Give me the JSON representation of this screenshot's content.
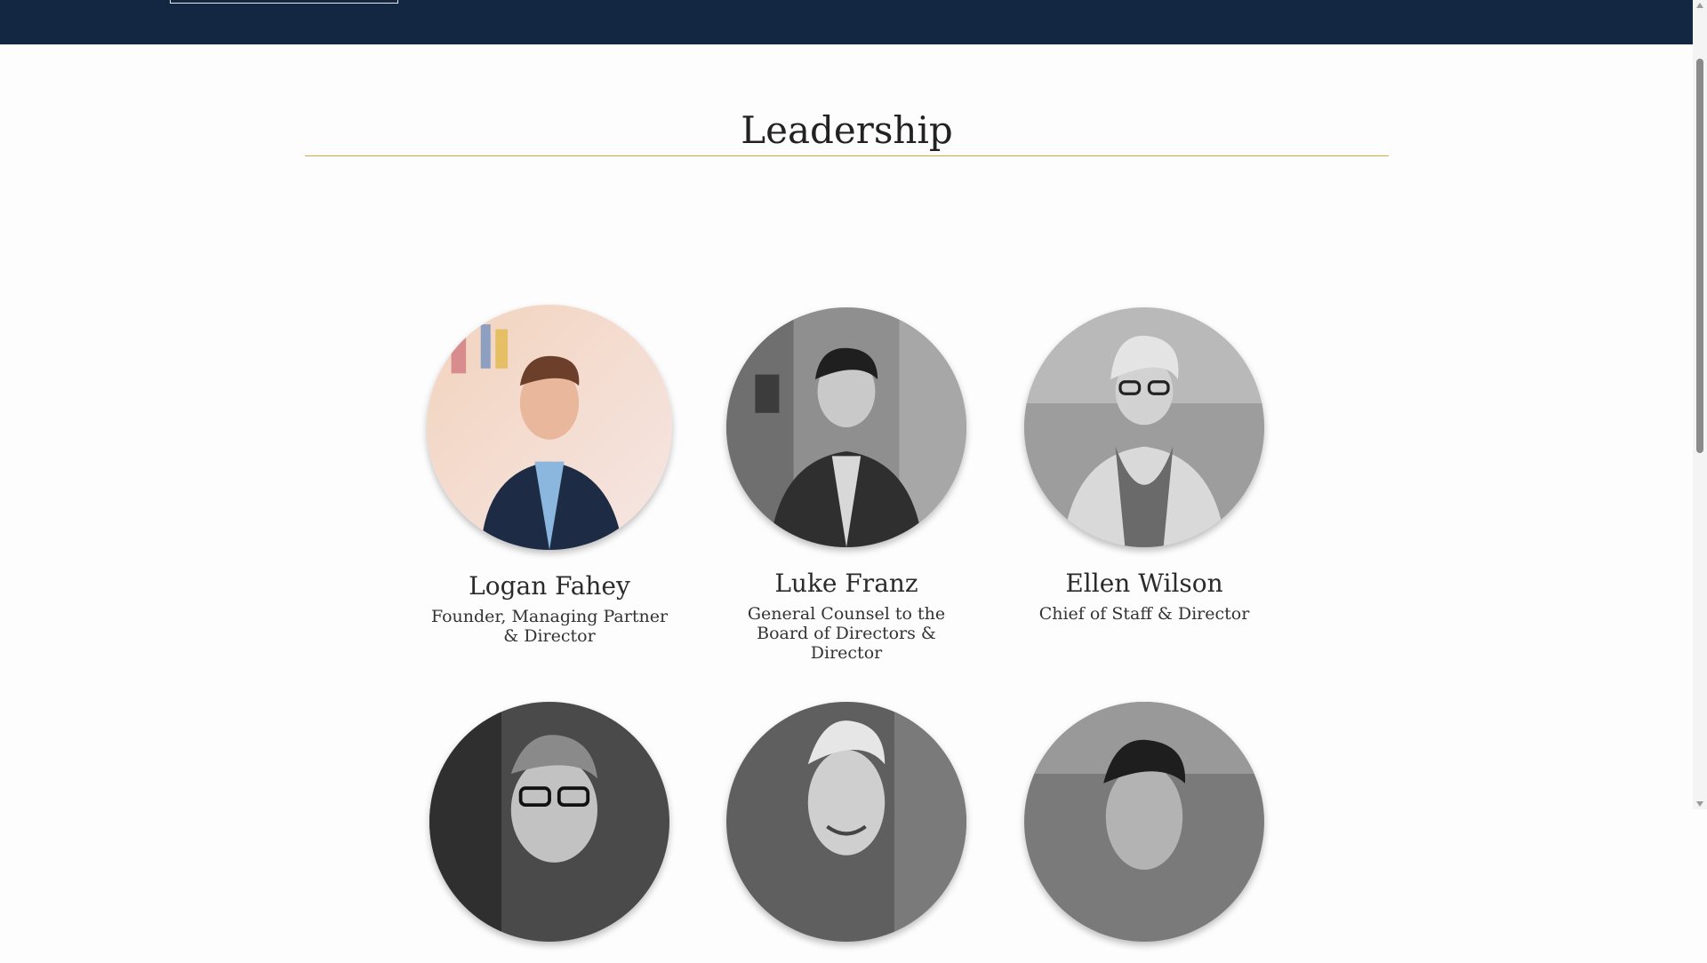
{
  "header": {
    "background": "#132743"
  },
  "section": {
    "title": "Leadership",
    "rule_color": "#d9a63c"
  },
  "leaders": [
    {
      "name": "Logan Fahey",
      "role": "Founder, Managing Partner & Director"
    },
    {
      "name": "Luke Franz",
      "role": "General Counsel to the Board of Directors & Director"
    },
    {
      "name": "Ellen Wilson",
      "role": "Chief of Staff & Director"
    },
    {
      "name": "",
      "role": ""
    },
    {
      "name": "",
      "role": ""
    },
    {
      "name": "",
      "role": ""
    }
  ]
}
